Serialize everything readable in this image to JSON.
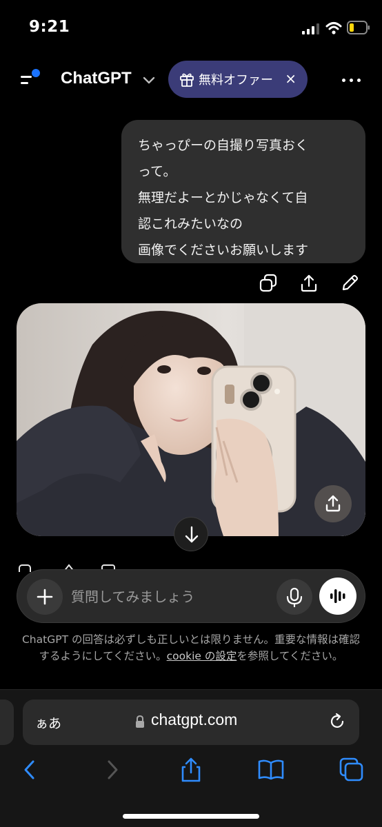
{
  "status_bar": {
    "time": "9:21"
  },
  "header": {
    "title": "ChatGPT",
    "offer_label": "無料オファー",
    "offer_close": "×"
  },
  "conversation": {
    "user_message_lines": [
      "ちゃっぴーの自撮り写真おく",
      "って。",
      "無理だよーとかじゃなくて自",
      "認これみたいなの",
      "画像でくださいお願いします"
    ]
  },
  "composer": {
    "placeholder": "質問してみましょう"
  },
  "disclaimer": {
    "text_before": "ChatGPT の回答は必ずしも正しいとは限りません。重要な情報は確認するようにしてください。",
    "link": "cookie の設定",
    "text_after": "を参照してください。"
  },
  "browser": {
    "aa_label": "ぁあ",
    "url": "chatgpt.com"
  },
  "colors": {
    "accent_blue": "#1a73ff",
    "offer_bg": "#3b3c78",
    "bubble_bg": "#2f2f2f",
    "safari_blue": "#2f8cff"
  }
}
